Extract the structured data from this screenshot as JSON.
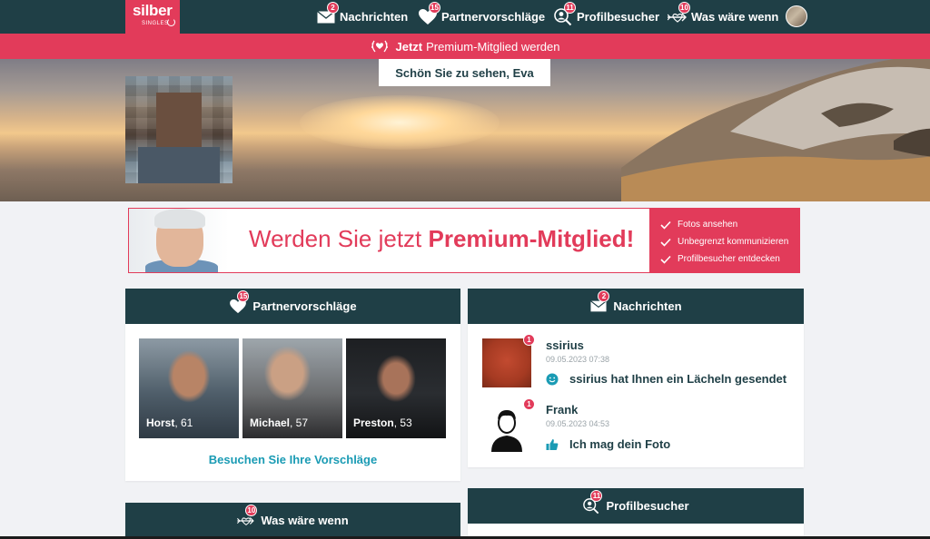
{
  "nav": {
    "logo_main": "silber",
    "logo_sub": "SINGLES",
    "items": [
      {
        "label": "Nachrichten",
        "badge": "2",
        "icon": "envelope-icon"
      },
      {
        "label": "Partnervorschläge",
        "badge": "15",
        "icon": "heart-icon"
      },
      {
        "label": "Profilbesucher",
        "badge": "11",
        "icon": "visitor-icon"
      },
      {
        "label": "Was wäre wenn",
        "badge": "10",
        "icon": "arrow-heart-icon"
      }
    ]
  },
  "premium_stripe": {
    "bold": "Jetzt",
    "text": "Premium-Mitglied werden"
  },
  "hero": {
    "greeting": "Schön Sie zu sehen, Eva"
  },
  "banner": {
    "text_pre": "Werden Sie jetzt",
    "text_bold": "Premium-Mitglied!",
    "features": [
      "Fotos ansehen",
      "Unbegrenzt kommunizieren",
      "Profilbesucher entdecken"
    ]
  },
  "suggestions_card": {
    "title": "Partnervorschläge",
    "badge": "15",
    "people": [
      {
        "name": "Horst",
        "age": ", 61"
      },
      {
        "name": "Michael",
        "age": ", 57"
      },
      {
        "name": "Preston",
        "age": ", 53"
      }
    ],
    "link": "Besuchen Sie Ihre Vorschläge"
  },
  "messages_card": {
    "title": "Nachrichten",
    "badge": "2",
    "messages": [
      {
        "name": "ssirius",
        "time": "09.05.2023 07:38",
        "text": "ssirius hat Ihnen ein Lächeln gesendet",
        "badge": "1"
      },
      {
        "name": "Frank",
        "time": "09.05.2023 04:53",
        "text": "Ich mag dein Foto",
        "badge": "1"
      }
    ]
  },
  "whatif_card": {
    "title": "Was wäre wenn",
    "badge": "10"
  },
  "visitors_card": {
    "title": "Profilbesucher",
    "badge": "11"
  },
  "colors": {
    "dark": "#1f3f46",
    "accent": "#e23b5a",
    "link": "#1a9bb4"
  }
}
